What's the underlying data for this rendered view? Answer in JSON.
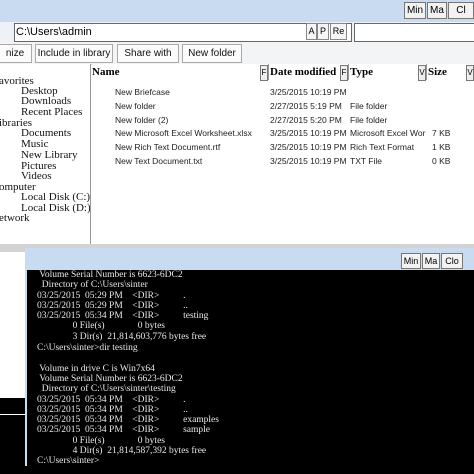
{
  "window": {
    "titlebar_buttons": [
      "Min",
      "Ma",
      "Cl"
    ]
  },
  "address": {
    "value": "C:\\Users\\admin",
    "btn_a": "A",
    "btn_p": "P",
    "btn_re": "Re"
  },
  "toolbar": {
    "organize": "nize",
    "include": "Include in library",
    "share": "Share with",
    "newfolder": "New folder"
  },
  "nav": {
    "items": [
      "avorites",
      "Desktop",
      "Downloads",
      "Recent Places",
      "ibraries",
      "Documents",
      "Music",
      "New Library",
      "Pictures",
      "Videos",
      "omputer",
      "Local Disk (C:)",
      "Local Disk (D:)",
      "etwork"
    ]
  },
  "columns": {
    "name": "Name",
    "date": "Date modified",
    "type": "Type",
    "size": "Size",
    "btn_f": "F",
    "btn_v": "V"
  },
  "files": [
    {
      "name": "New Briefcase",
      "date": "3/25/2015 10:19 PM",
      "type": "",
      "size": ""
    },
    {
      "name": "New folder",
      "date": "2/27/2015 5:19 PM",
      "type": "File folder",
      "size": ""
    },
    {
      "name": "New folder (2)",
      "date": "2/27/2015 5:20 PM",
      "type": "File folder",
      "size": ""
    },
    {
      "name": "New Microsoft Excel Worksheet.xlsx",
      "date": "3/25/2015 10:19 PM",
      "type": "Microsoft Excel Wor",
      "size": "7 KB"
    },
    {
      "name": "New Rich Text Document.rtf",
      "date": "3/25/2015 10:19 PM",
      "type": "Rich Text Format",
      "size": "1 KB"
    },
    {
      "name": "New Text Document.txt",
      "date": "3/25/2015 10:19 PM",
      "type": "TXT File",
      "size": "0 KB"
    }
  ],
  "cmd": {
    "titlebar_buttons": [
      "Min",
      "Ma",
      "Clo"
    ],
    "lines": [
      " Volume Serial Number is 6623-6DC2",
      "  Directory of C:\\Users\\sinter",
      "03/25/2015  05:29 PM    <DIR>          .",
      "03/25/2015  05:29 PM    <DIR>          ..",
      "03/25/2015  05:34 PM    <DIR>          testing",
      "               0 File(s)              0 bytes",
      "               3 Dir(s)  21,814,603,776 bytes free",
      "C:\\Users\\sinter>dir testing",
      "",
      " Volume in drive C is Win7x64",
      " Volume Serial Number is 6623-6DC2",
      "  Directory of C:\\Users\\sinter\\testing",
      "03/25/2015  05:34 PM    <DIR>          .",
      "03/25/2015  05:34 PM    <DIR>          ..",
      "03/25/2015  05:34 PM    <DIR>          examples",
      "03/25/2015  05:34 PM    <DIR>          sample",
      "               0 File(s)              0 bytes",
      "               4 Dir(s)  21,814,587,392 bytes free",
      "C:\\Users\\sinter>"
    ]
  },
  "colors": {
    "titlebar": "#c9dbf0",
    "console_bg": "#000000",
    "console_text": "#e8e8e8"
  }
}
